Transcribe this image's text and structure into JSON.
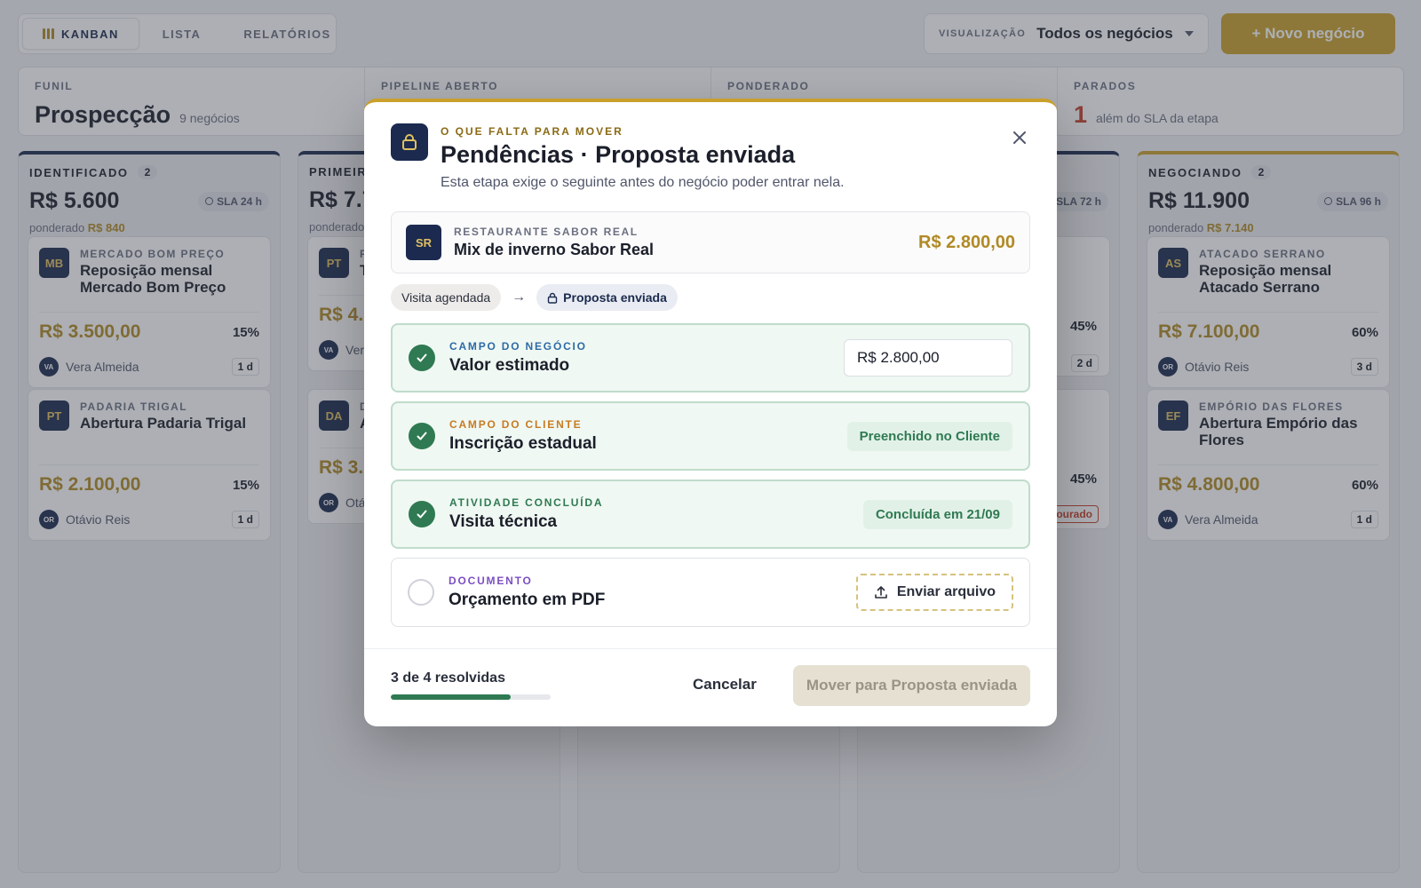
{
  "topbar": {
    "tabs": [
      {
        "label": "KANBAN"
      },
      {
        "label": "LISTA"
      },
      {
        "label": "RELATÓRIOS"
      }
    ],
    "view_label": "VISUALIZAÇÃO",
    "view_value": "Todos os negócios",
    "new_deal": "+ Novo negócio"
  },
  "stats": {
    "funnel": {
      "label": "FUNIL",
      "value": "Prospecção",
      "sub": "9 negócios"
    },
    "pipeline": {
      "label": "PIPELINE ABERTO"
    },
    "weighted": {
      "label": "PONDERADO"
    },
    "stalled": {
      "label": "PARADOS",
      "value": "1",
      "sub": "além do SLA da etapa"
    }
  },
  "columns": {
    "identificado": {
      "title": "IDENTIFICADO",
      "count": "2",
      "amount": "R$ 5.600",
      "sla": "SLA 24 h",
      "weighted_label": "ponderado",
      "weighted_value": "R$ 840",
      "cards": [
        {
          "badge": "MB",
          "company": "MERCADO BOM PREÇO",
          "name": "Reposição mensal Mercado Bom Preço",
          "value": "R$ 3.500,00",
          "pct": "15%",
          "owner_initials": "VA",
          "owner": "Vera Almeida",
          "days": "1 d"
        },
        {
          "badge": "PT",
          "company": "PADARIA TRIGAL",
          "name": "Abertura Padaria Trigal",
          "value": "R$ 2.100,00",
          "pct": "15%",
          "owner_initials": "OR",
          "owner": "Otávio Reis",
          "days": "1 d"
        }
      ]
    },
    "primeiro": {
      "title": "PRIMEIRO",
      "amount": "R$ 7.7",
      "weighted_label": "ponderado",
      "cards": [
        {
          "badge": "PT",
          "company": "P",
          "name": "T",
          "value": "R$ 4.",
          "owner_initials": "VA",
          "owner": "Ver"
        },
        {
          "badge": "DA",
          "company": "D",
          "name": "A",
          "value": "R$ 3.",
          "owner_initials": "OR",
          "owner": "Otá"
        }
      ]
    },
    "col4": {
      "sla": "SLA 72 h",
      "cards": [
        {
          "pct": "45%",
          "days": "2 d"
        },
        {
          "pct": "45%",
          "days": "ourado"
        }
      ]
    },
    "negociando": {
      "title": "NEGOCIANDO",
      "count": "2",
      "amount": "R$ 11.900",
      "sla": "SLA 96 h",
      "weighted_label": "ponderado",
      "weighted_value": "R$ 7.140",
      "cards": [
        {
          "badge": "AS",
          "company": "ATACADO SERRANO",
          "name": "Reposição mensal Atacado Serrano",
          "value": "R$ 7.100,00",
          "pct": "60%",
          "owner_initials": "OR",
          "owner": "Otávio Reis",
          "days": "3 d"
        },
        {
          "badge": "EF",
          "company": "EMPÓRIO DAS FLORES",
          "name": "Abertura Empório das Flores",
          "value": "R$ 4.800,00",
          "pct": "60%",
          "owner_initials": "VA",
          "owner": "Vera Almeida",
          "days": "1 d"
        }
      ]
    }
  },
  "modal": {
    "eyebrow": "O QUE FALTA PARA MOVER",
    "title": "Pendências · Proposta enviada",
    "subtitle": "Esta etapa exige o seguinte antes do negócio poder entrar nela.",
    "deal": {
      "badge": "SR",
      "company": "RESTAURANTE SABOR REAL",
      "name": "Mix de inverno Sabor Real",
      "value": "R$ 2.800,00"
    },
    "from_stage": "Visita agendada",
    "to_stage": "Proposta enviada",
    "requirements": [
      {
        "kind": "CAMPO DO NEGÓCIO",
        "name": "Valor estimado",
        "input_value": "R$ 2.800,00",
        "done": true
      },
      {
        "kind": "CAMPO DO CLIENTE",
        "name": "Inscrição estadual",
        "status": "Preenchido no Cliente",
        "done": true
      },
      {
        "kind": "ATIVIDADE CONCLUÍDA",
        "name": "Visita técnica",
        "status": "Concluída em 21/09",
        "done": true
      },
      {
        "kind": "DOCUMENTO",
        "name": "Orçamento em PDF",
        "action": "Enviar arquivo",
        "done": false
      }
    ],
    "progress_text": "3 de 4 resolvidas",
    "progress_resolved": 3,
    "progress_total": 4,
    "cancel": "Cancelar",
    "move": "Mover para Proposta enviada"
  },
  "colors": {
    "navy": "#1b2a4e",
    "gold": "#c9a02b",
    "success": "#2f7a52",
    "danger": "#c6402a"
  }
}
